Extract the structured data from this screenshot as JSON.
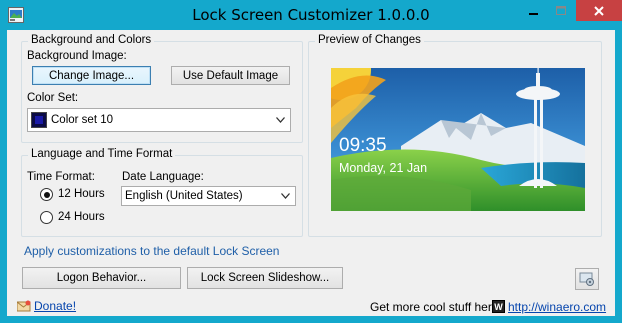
{
  "window": {
    "title": "Lock Screen Customizer 1.0.0.0",
    "title_bar_color": "#14a8cc",
    "close_button_color": "#c74142"
  },
  "background_group": {
    "title": "Background and Colors",
    "background_image_label": "Background Image:",
    "change_image_button": "Change Image...",
    "default_image_button": "Use Default Image",
    "color_set_label": "Color Set:",
    "color_set_value": "Color set 10",
    "color_set_swatch": "#1a1aa6"
  },
  "language_group": {
    "title": "Language and Time Format",
    "time_format_label": "Time Format:",
    "time_12": "12 Hours",
    "time_24": "24 Hours",
    "time_selected": "12 Hours",
    "date_language_label": "Date Language:",
    "date_language_value": "English (United States)"
  },
  "preview_group": {
    "title": "Preview of Changes",
    "clock": "09:35",
    "date": "Monday, 21 Jan"
  },
  "apply_link": "Apply customizations to the default Lock Screen",
  "logon_behavior_button": "Logon Behavior...",
  "slideshow_button": "Lock Screen Slideshow...",
  "footer": {
    "donate": "Donate!",
    "more_stuff": "Get more cool stuff here:",
    "winaero_badge": "W",
    "winaero_link": "http://winaero.com"
  },
  "accent_link_color": "#0645ad"
}
